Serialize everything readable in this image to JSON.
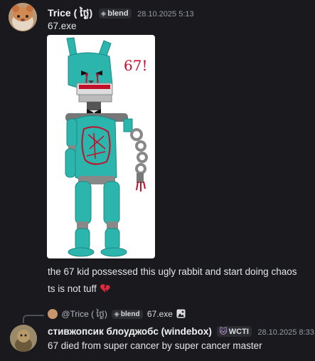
{
  "message1": {
    "author": "Trice ( ថ្ងៃ)",
    "tag_label": "blend",
    "timestamp": "28.10.2025 5:13",
    "attachment_name": "67.exe",
    "drawing_text": "67!",
    "lines": [
      "the 67 kid possessed this ugly rabbit and start doing chaos",
      "ts is not tuff"
    ],
    "emoji": "broken-heart"
  },
  "reply": {
    "ref_author": "@Trice ( ថ្ងៃ)",
    "ref_tag": "blend",
    "ref_text": "67.exe",
    "ref_icon": "image-icon",
    "author": "стивжопсик блоуджобс (windebox)",
    "tag_label": "WCTI",
    "timestamp": "28.10.2025 8:33",
    "text": "67 died from super cancer by super cancer master"
  },
  "colors": {
    "background": "#1a1a1e",
    "rabbit": "#2bb5ad",
    "blood": "#c0102a"
  }
}
